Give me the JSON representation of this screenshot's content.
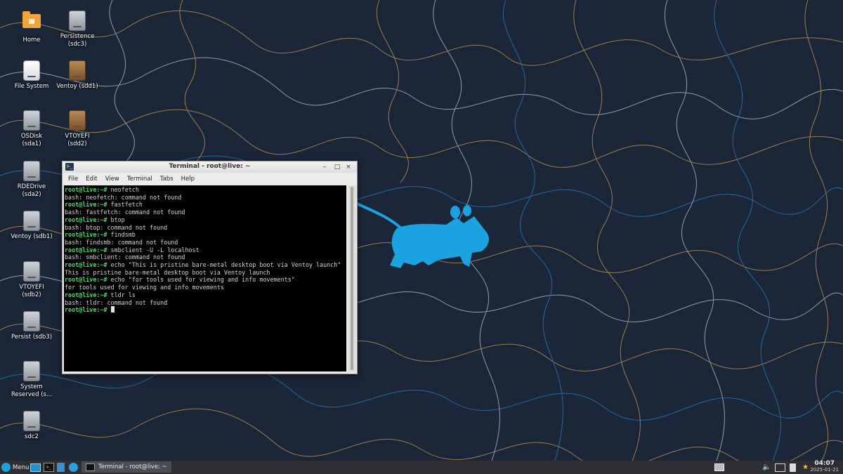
{
  "desktop": {
    "icons": [
      {
        "label": "Home",
        "type": "folder"
      },
      {
        "label": "Persistence\n(sdc3)",
        "type": "drive"
      },
      {
        "label": "File System",
        "type": "drive-white"
      },
      {
        "label": "Ventoy (sdd1)",
        "type": "drive-brown"
      },
      {
        "label": "OSDisk\n(sda1)",
        "type": "drive"
      },
      {
        "label": "VTOYEFI\n(sdd2)",
        "type": "drive-brown"
      },
      {
        "label": "RDEDrive\n(sda2)",
        "type": "drive"
      },
      {
        "label": "Ventoy (sdb1)",
        "type": "drive"
      },
      {
        "label": "VTOYEFI\n(sdb2)",
        "type": "drive"
      },
      {
        "label": "Persist (sdb3)",
        "type": "drive"
      },
      {
        "label": "System\nReserved (s...",
        "type": "drive"
      },
      {
        "label": "sdc2",
        "type": "drive"
      }
    ],
    "mascot_color": "#1aa3e0"
  },
  "terminal": {
    "title": "Terminal - root@live: ~",
    "menu": [
      "File",
      "Edit",
      "View",
      "Terminal",
      "Tabs",
      "Help"
    ],
    "buttons": {
      "minimize": "‒",
      "maximize": "□",
      "close": "×"
    },
    "prompt": "root@live:~#",
    "lines": [
      {
        "type": "cmd",
        "text": " neofetch"
      },
      {
        "type": "out",
        "text": "bash: neofetch: command not found"
      },
      {
        "type": "cmd",
        "text": " fastfetch"
      },
      {
        "type": "out",
        "text": "bash: fastfetch: command not found"
      },
      {
        "type": "cmd",
        "text": " btop"
      },
      {
        "type": "out",
        "text": "bash: btop: command not found"
      },
      {
        "type": "cmd",
        "text": " findsmb"
      },
      {
        "type": "out",
        "text": "bash: findsmb: command not found"
      },
      {
        "type": "cmd",
        "text": " smbclient -U -L localhost"
      },
      {
        "type": "out",
        "text": "bash: smbclient: command not found"
      },
      {
        "type": "cmd",
        "text": " echo \"This is pristine bare-metal desktop boot via Ventoy launch\""
      },
      {
        "type": "out",
        "text": "This is pristine bare-metal desktop boot via Ventoy launch"
      },
      {
        "type": "cmd",
        "text": " echo \"for tools used for viewing and info movements\""
      },
      {
        "type": "out",
        "text": "for tools used for viewing and info movements"
      },
      {
        "type": "cmd",
        "text": " tldr ls"
      },
      {
        "type": "out",
        "text": "bash: tldr: command not found"
      },
      {
        "type": "cursor",
        "text": " "
      }
    ]
  },
  "taskbar": {
    "menu_label": "Menu",
    "task_label": "Terminal - root@live: ~",
    "time": "04:07",
    "date": "2025-01-21"
  }
}
